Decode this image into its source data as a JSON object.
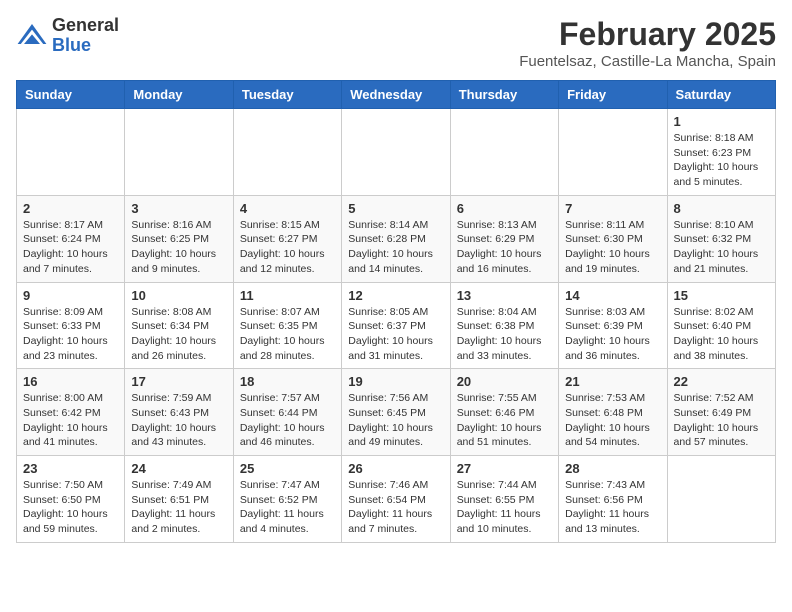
{
  "header": {
    "logo_general": "General",
    "logo_blue": "Blue",
    "month_title": "February 2025",
    "location": "Fuentelsaz, Castille-La Mancha, Spain"
  },
  "weekdays": [
    "Sunday",
    "Monday",
    "Tuesday",
    "Wednesday",
    "Thursday",
    "Friday",
    "Saturday"
  ],
  "weeks": [
    [
      {
        "day": "",
        "info": ""
      },
      {
        "day": "",
        "info": ""
      },
      {
        "day": "",
        "info": ""
      },
      {
        "day": "",
        "info": ""
      },
      {
        "day": "",
        "info": ""
      },
      {
        "day": "",
        "info": ""
      },
      {
        "day": "1",
        "info": "Sunrise: 8:18 AM\nSunset: 6:23 PM\nDaylight: 10 hours\nand 5 minutes."
      }
    ],
    [
      {
        "day": "2",
        "info": "Sunrise: 8:17 AM\nSunset: 6:24 PM\nDaylight: 10 hours\nand 7 minutes."
      },
      {
        "day": "3",
        "info": "Sunrise: 8:16 AM\nSunset: 6:25 PM\nDaylight: 10 hours\nand 9 minutes."
      },
      {
        "day": "4",
        "info": "Sunrise: 8:15 AM\nSunset: 6:27 PM\nDaylight: 10 hours\nand 12 minutes."
      },
      {
        "day": "5",
        "info": "Sunrise: 8:14 AM\nSunset: 6:28 PM\nDaylight: 10 hours\nand 14 minutes."
      },
      {
        "day": "6",
        "info": "Sunrise: 8:13 AM\nSunset: 6:29 PM\nDaylight: 10 hours\nand 16 minutes."
      },
      {
        "day": "7",
        "info": "Sunrise: 8:11 AM\nSunset: 6:30 PM\nDaylight: 10 hours\nand 19 minutes."
      },
      {
        "day": "8",
        "info": "Sunrise: 8:10 AM\nSunset: 6:32 PM\nDaylight: 10 hours\nand 21 minutes."
      }
    ],
    [
      {
        "day": "9",
        "info": "Sunrise: 8:09 AM\nSunset: 6:33 PM\nDaylight: 10 hours\nand 23 minutes."
      },
      {
        "day": "10",
        "info": "Sunrise: 8:08 AM\nSunset: 6:34 PM\nDaylight: 10 hours\nand 26 minutes."
      },
      {
        "day": "11",
        "info": "Sunrise: 8:07 AM\nSunset: 6:35 PM\nDaylight: 10 hours\nand 28 minutes."
      },
      {
        "day": "12",
        "info": "Sunrise: 8:05 AM\nSunset: 6:37 PM\nDaylight: 10 hours\nand 31 minutes."
      },
      {
        "day": "13",
        "info": "Sunrise: 8:04 AM\nSunset: 6:38 PM\nDaylight: 10 hours\nand 33 minutes."
      },
      {
        "day": "14",
        "info": "Sunrise: 8:03 AM\nSunset: 6:39 PM\nDaylight: 10 hours\nand 36 minutes."
      },
      {
        "day": "15",
        "info": "Sunrise: 8:02 AM\nSunset: 6:40 PM\nDaylight: 10 hours\nand 38 minutes."
      }
    ],
    [
      {
        "day": "16",
        "info": "Sunrise: 8:00 AM\nSunset: 6:42 PM\nDaylight: 10 hours\nand 41 minutes."
      },
      {
        "day": "17",
        "info": "Sunrise: 7:59 AM\nSunset: 6:43 PM\nDaylight: 10 hours\nand 43 minutes."
      },
      {
        "day": "18",
        "info": "Sunrise: 7:57 AM\nSunset: 6:44 PM\nDaylight: 10 hours\nand 46 minutes."
      },
      {
        "day": "19",
        "info": "Sunrise: 7:56 AM\nSunset: 6:45 PM\nDaylight: 10 hours\nand 49 minutes."
      },
      {
        "day": "20",
        "info": "Sunrise: 7:55 AM\nSunset: 6:46 PM\nDaylight: 10 hours\nand 51 minutes."
      },
      {
        "day": "21",
        "info": "Sunrise: 7:53 AM\nSunset: 6:48 PM\nDaylight: 10 hours\nand 54 minutes."
      },
      {
        "day": "22",
        "info": "Sunrise: 7:52 AM\nSunset: 6:49 PM\nDaylight: 10 hours\nand 57 minutes."
      }
    ],
    [
      {
        "day": "23",
        "info": "Sunrise: 7:50 AM\nSunset: 6:50 PM\nDaylight: 10 hours\nand 59 minutes."
      },
      {
        "day": "24",
        "info": "Sunrise: 7:49 AM\nSunset: 6:51 PM\nDaylight: 11 hours\nand 2 minutes."
      },
      {
        "day": "25",
        "info": "Sunrise: 7:47 AM\nSunset: 6:52 PM\nDaylight: 11 hours\nand 4 minutes."
      },
      {
        "day": "26",
        "info": "Sunrise: 7:46 AM\nSunset: 6:54 PM\nDaylight: 11 hours\nand 7 minutes."
      },
      {
        "day": "27",
        "info": "Sunrise: 7:44 AM\nSunset: 6:55 PM\nDaylight: 11 hours\nand 10 minutes."
      },
      {
        "day": "28",
        "info": "Sunrise: 7:43 AM\nSunset: 6:56 PM\nDaylight: 11 hours\nand 13 minutes."
      },
      {
        "day": "",
        "info": ""
      }
    ]
  ]
}
